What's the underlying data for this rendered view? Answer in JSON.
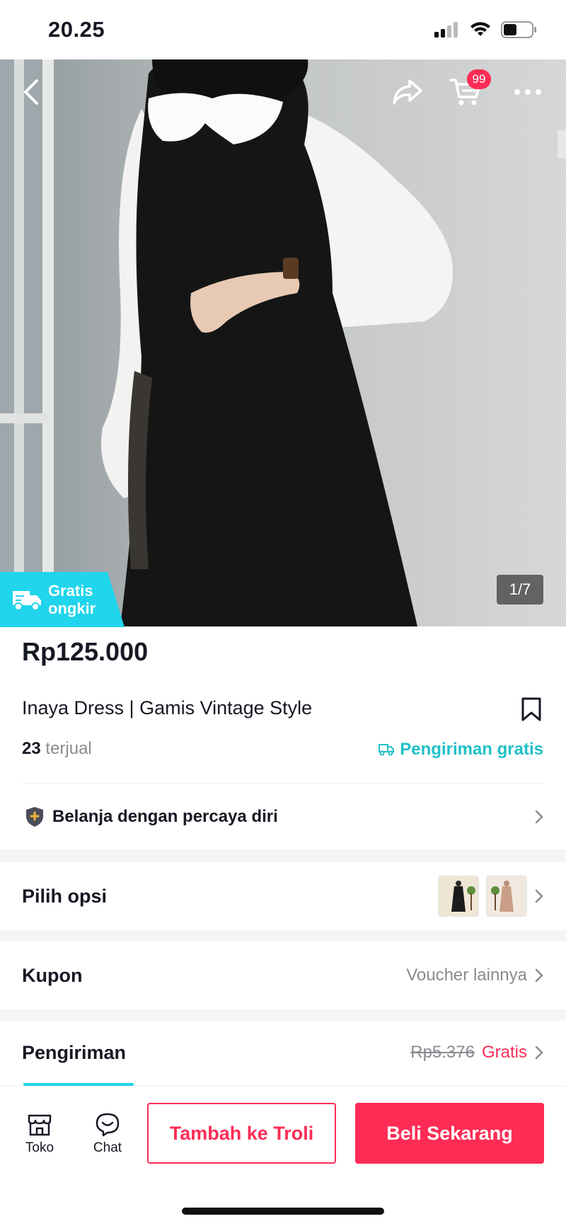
{
  "status_bar": {
    "time": "20.25"
  },
  "top_nav": {
    "cart_count": "99"
  },
  "gallery": {
    "counter": "1/7",
    "free_shipping_badge": "Gratis ongkir"
  },
  "product": {
    "price": "Rp125.000",
    "title": "Inaya Dress | Gamis Vintage Style",
    "sold_count": "23",
    "sold_label": "terjual",
    "shipping_label": "Pengiriman gratis"
  },
  "trust": {
    "label": "Belanja dengan percaya diri"
  },
  "rows": {
    "options_label": "Pilih opsi",
    "coupon_label": "Kupon",
    "coupon_value": "Voucher lainnya",
    "shipping_label": "Pengiriman",
    "shipping_old_price": "Rp5.376",
    "shipping_new_price": "Gratis"
  },
  "bottom_bar": {
    "shop_label": "Toko",
    "chat_label": "Chat",
    "add_to_cart": "Tambah ke Troli",
    "buy_now": "Beli Sekarang"
  },
  "colors": {
    "accent": "#fe2c55",
    "teal": "#20d5ec",
    "text": "#161823"
  }
}
